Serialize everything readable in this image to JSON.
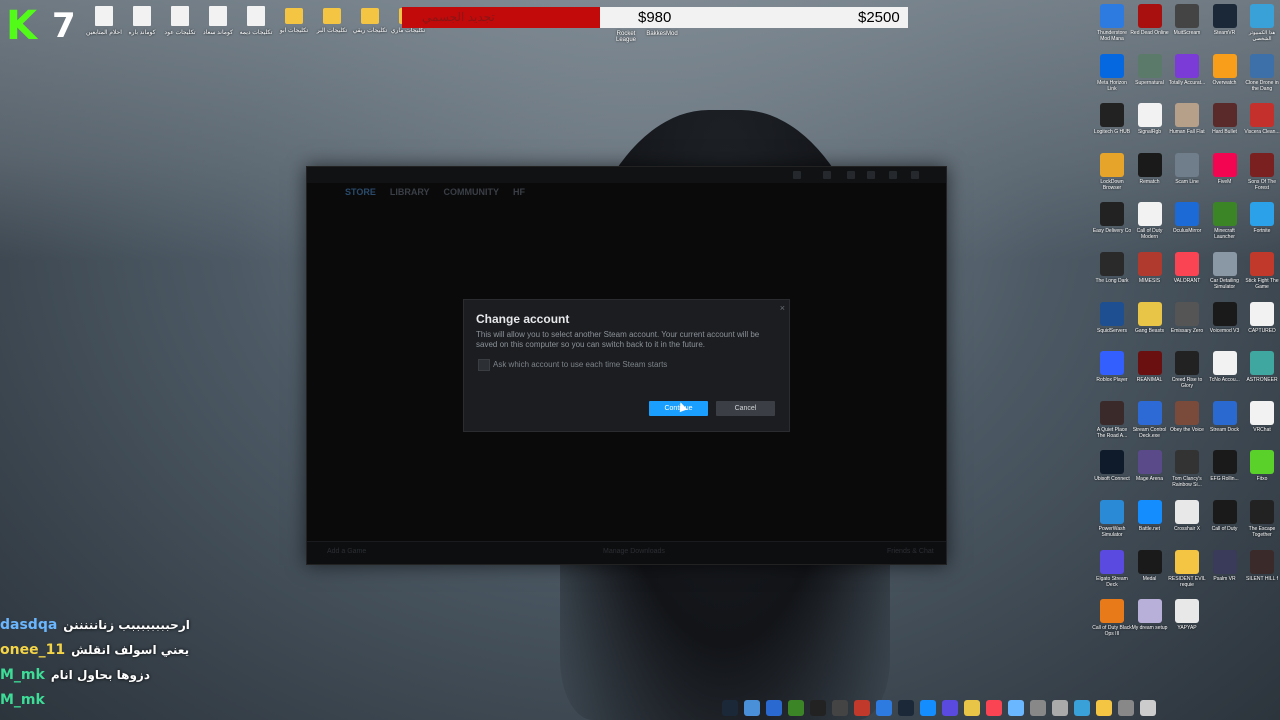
{
  "overlay": {
    "channel_letter": "K",
    "counter": "7",
    "top_icons": [
      {
        "label": "احلام المتابعين",
        "kind": "file"
      },
      {
        "label": "كوماند باره",
        "kind": "file"
      },
      {
        "label": "تكليجات عود",
        "kind": "file"
      },
      {
        "label": "كوماند سعاد",
        "kind": "file"
      },
      {
        "label": "تكليجات ديمه",
        "kind": "file"
      },
      {
        "label": "تكليجات ابو",
        "kind": "folder"
      },
      {
        "label": "تكليجات البر",
        "kind": "folder"
      },
      {
        "label": "تكليجات ريقي",
        "kind": "folder"
      },
      {
        "label": "تكليجات ماري",
        "kind": "folder"
      }
    ],
    "goal": {
      "label": "تجديد الجسمي",
      "current": "$980",
      "target": "$2500",
      "progress": 0.392,
      "fill_color": "#c20a0a"
    },
    "mid_icons": [
      {
        "label": "Rocket League"
      },
      {
        "label": "BakkesMod"
      }
    ]
  },
  "steam": {
    "nav": [
      "STORE",
      "LIBRARY",
      "COMMUNITY",
      "HF"
    ],
    "footer_left": "Add a Game",
    "footer_center": "Manage Downloads",
    "footer_right": "Friends & Chat"
  },
  "dialog": {
    "title": "Change account",
    "body": "This will allow you to select another Steam account. Your current account will be saved on this computer so you can switch back to it in the future.",
    "checkbox_label": "Ask which account to use each time Steam starts",
    "continue_label": "Continue",
    "cancel_label": "Cancel",
    "close_glyph": "×",
    "accent": "#1a9fff"
  },
  "desktop_icons": [
    {
      "label": "Thunderstore Mod Mana",
      "color": "#2d7be0"
    },
    {
      "label": "Red Dead Online",
      "color": "#a81010"
    },
    {
      "label": "MuitScream",
      "color": "#444"
    },
    {
      "label": "SteamVR",
      "color": "#1b2838"
    },
    {
      "label": "هذا الكمبيوتر الشخصي",
      "color": "#3aa0d8"
    },
    {
      "label": "Meta Horizon Link",
      "color": "#0668e1"
    },
    {
      "label": "Supernatural",
      "color": "#5c7a6a"
    },
    {
      "label": "Totally Accurat...",
      "color": "#7a3bd6"
    },
    {
      "label": "Overwatch",
      "color": "#f99e1a"
    },
    {
      "label": "Clone Drone in the Dang",
      "color": "#3d6fa8"
    },
    {
      "label": "Logitech G HUB",
      "color": "#222"
    },
    {
      "label": "SignalRgb",
      "color": "#f2f2f2"
    },
    {
      "label": "Human Fall Flat",
      "color": "#b7a08a"
    },
    {
      "label": "Hard Bullet",
      "color": "#5a2a2a"
    },
    {
      "label": "Viscera Clean...",
      "color": "#c4302b"
    },
    {
      "label": "LockDown Browser",
      "color": "#e6a42a"
    },
    {
      "label": "Rematch",
      "color": "#1a1a1a"
    },
    {
      "label": "Scam Line",
      "color": "#6f7e8a"
    },
    {
      "label": "FiveM",
      "color": "#f40552"
    },
    {
      "label": "Sons Of The Forest",
      "color": "#7a2020"
    },
    {
      "label": "Easy Delivery Co",
      "color": "#222"
    },
    {
      "label": "Call of Duty Modern",
      "color": "#f2f2f2"
    },
    {
      "label": "OculusMirror",
      "color": "#1b6ad6"
    },
    {
      "label": "Minecraft Launcher",
      "color": "#3c8527"
    },
    {
      "label": "Fortnite",
      "color": "#2aa1e8"
    },
    {
      "label": "The Long Dark",
      "color": "#2a2a2a"
    },
    {
      "label": "MIMESIS",
      "color": "#b03a2e"
    },
    {
      "label": "VALORANT",
      "color": "#fa4454"
    },
    {
      "label": "Car Detailing Simulator",
      "color": "#8a98a6"
    },
    {
      "label": "Stick Fight The Game",
      "color": "#c0392b"
    },
    {
      "label": "SquidServers",
      "color": "#1d4f91"
    },
    {
      "label": "Gang Beasts",
      "color": "#e8c547"
    },
    {
      "label": "Emissary Zero",
      "color": "#555"
    },
    {
      "label": "Voicemod V3",
      "color": "#1a1a1a"
    },
    {
      "label": "CAPTURED",
      "color": "#f2f2f2"
    },
    {
      "label": "Roblox Player",
      "color": "#335fff"
    },
    {
      "label": "REANIMAL",
      "color": "#6a1010"
    },
    {
      "label": "Creed Rise to Glory",
      "color": "#222"
    },
    {
      "label": "TcNo Accou...",
      "color": "#f2f2f2"
    },
    {
      "label": "ASTRONEER",
      "color": "#3fa7a0"
    },
    {
      "label": "A Quiet Place The Road A...",
      "color": "#3a2a2a"
    },
    {
      "label": "Stream Control Deck.exe",
      "color": "#2e6ad6"
    },
    {
      "label": "Obey the Voice",
      "color": "#7a4a3a"
    },
    {
      "label": "Stream Dock",
      "color": "#2a6ad0"
    },
    {
      "label": "VRChat",
      "color": "#f2f2f2"
    },
    {
      "label": "Ubisoft Connect",
      "color": "#0f1a2a"
    },
    {
      "label": "Mage Arena",
      "color": "#5a4a8a"
    },
    {
      "label": "Tom Clancy's Rainbow Si...",
      "color": "#333"
    },
    {
      "label": "EFG Rollin...",
      "color": "#1a1a1a"
    },
    {
      "label": "Fitxo",
      "color": "#5ad02a"
    },
    {
      "label": "PowerWash Simulator",
      "color": "#2a8ad6"
    },
    {
      "label": "Battle.net",
      "color": "#148eff"
    },
    {
      "label": "Crosshair X",
      "color": "#e8e8e8"
    },
    {
      "label": "Call of Duty",
      "color": "#1a1a1a"
    },
    {
      "label": "The Escape Together",
      "color": "#222"
    },
    {
      "label": "Elgato Stream Deck",
      "color": "#5a4ae0"
    },
    {
      "label": "Medal",
      "color": "#1a1a1a"
    },
    {
      "label": "RESIDENT EVIL requie",
      "color": "#f4c542"
    },
    {
      "label": "Psalm VR",
      "color": "#3a3a5a"
    },
    {
      "label": "SILENT HILL f",
      "color": "#3a2a2a"
    },
    {
      "label": "Call of Duty Black Ops III",
      "color": "#e87a1a"
    },
    {
      "label": "My dream setup",
      "color": "#b8b0d8"
    },
    {
      "label": "YAPYAP",
      "color": "#e8e8e8"
    }
  ],
  "chat": [
    {
      "user": "dasdqa",
      "message": "ارحببببببببب زنانننننن",
      "color": "b"
    },
    {
      "user": "onee_11",
      "message": "يعني اسولف انقلش",
      "color": "y"
    },
    {
      "user": "M_mk",
      "message": "دزوها بحاول انام",
      "color": "g"
    },
    {
      "user": "M_mk",
      "message": "",
      "color": "g"
    }
  ],
  "tray_colors": [
    "#1b2838",
    "#4a90d9",
    "#2a6ad0",
    "#3c8527",
    "#222",
    "#444",
    "#c0392b",
    "#2d7be0",
    "#1b2838",
    "#148eff",
    "#5a4ae0",
    "#e8c547",
    "#fa4454",
    "#6ab7ff",
    "#888",
    "#aaa",
    "#3aa0d8",
    "#f4c542",
    "#888",
    "#ccc"
  ]
}
